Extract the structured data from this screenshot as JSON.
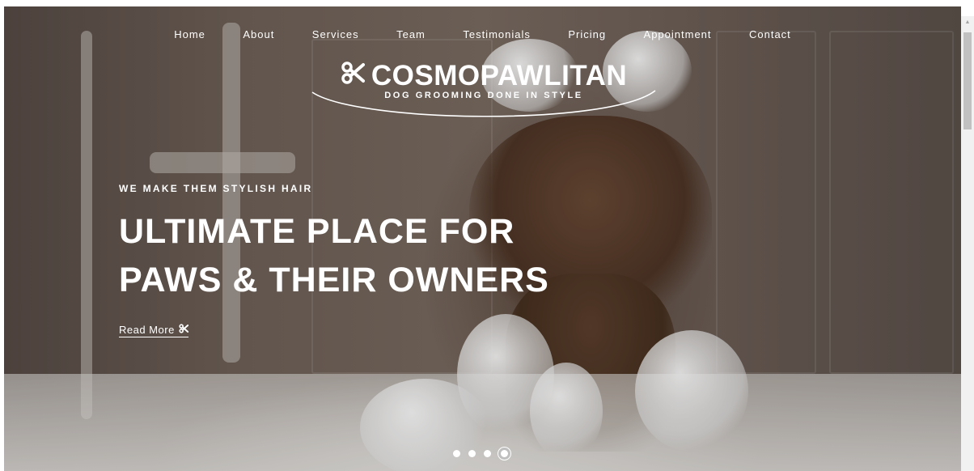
{
  "nav": {
    "items": [
      {
        "label": "Home"
      },
      {
        "label": "About"
      },
      {
        "label": "Services"
      },
      {
        "label": "Team"
      },
      {
        "label": "Testimonials"
      },
      {
        "label": "Pricing"
      },
      {
        "label": "Appointment"
      },
      {
        "label": "Contact"
      }
    ]
  },
  "logo": {
    "brand": "COSMOPAWLITAN",
    "tagline": "DOG GROOMING DONE IN STYLE",
    "icon": "scissors-icon"
  },
  "hero": {
    "eyebrow": "WE MAKE THEM STYLISH HAIR",
    "headline_line1": "ULTIMATE PLACE FOR",
    "headline_line2": "PAWS & THEIR OWNERS",
    "read_more": "Read More",
    "read_more_icon": "scissors-icon"
  },
  "slider": {
    "slide_count": 4,
    "active_slide": 4
  },
  "colors": {
    "text": "#ffffff",
    "scrollbar_track": "#f1f1f1",
    "scrollbar_thumb": "#c1c1c1"
  }
}
